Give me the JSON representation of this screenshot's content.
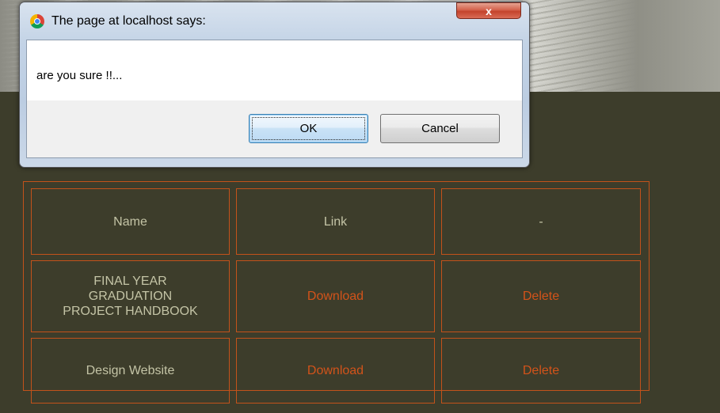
{
  "dialog": {
    "title": "The page at localhost says:",
    "close_label": "x",
    "message": "are you sure !!...",
    "ok_label": "OK",
    "cancel_label": "Cancel"
  },
  "table": {
    "headers": [
      "Name",
      "Link",
      "-"
    ],
    "rows": [
      {
        "name": "FINAL YEAR GRADUATION PROJECT HANDBOOK",
        "name_lines": [
          "FINAL YEAR",
          "GRADUATION",
          "PROJECT HANDBOOK"
        ],
        "link": "Download",
        "action": "Delete"
      },
      {
        "name": "Design Website",
        "link": "Download",
        "action": "Delete"
      }
    ]
  },
  "colors": {
    "page_background": "#3d3d2b",
    "table_border": "#c3521a",
    "action_text": "#d2531a",
    "plain_text": "#c4c4a6"
  },
  "icons": {
    "dialog_icon": "chrome-icon",
    "close": "close-icon"
  }
}
